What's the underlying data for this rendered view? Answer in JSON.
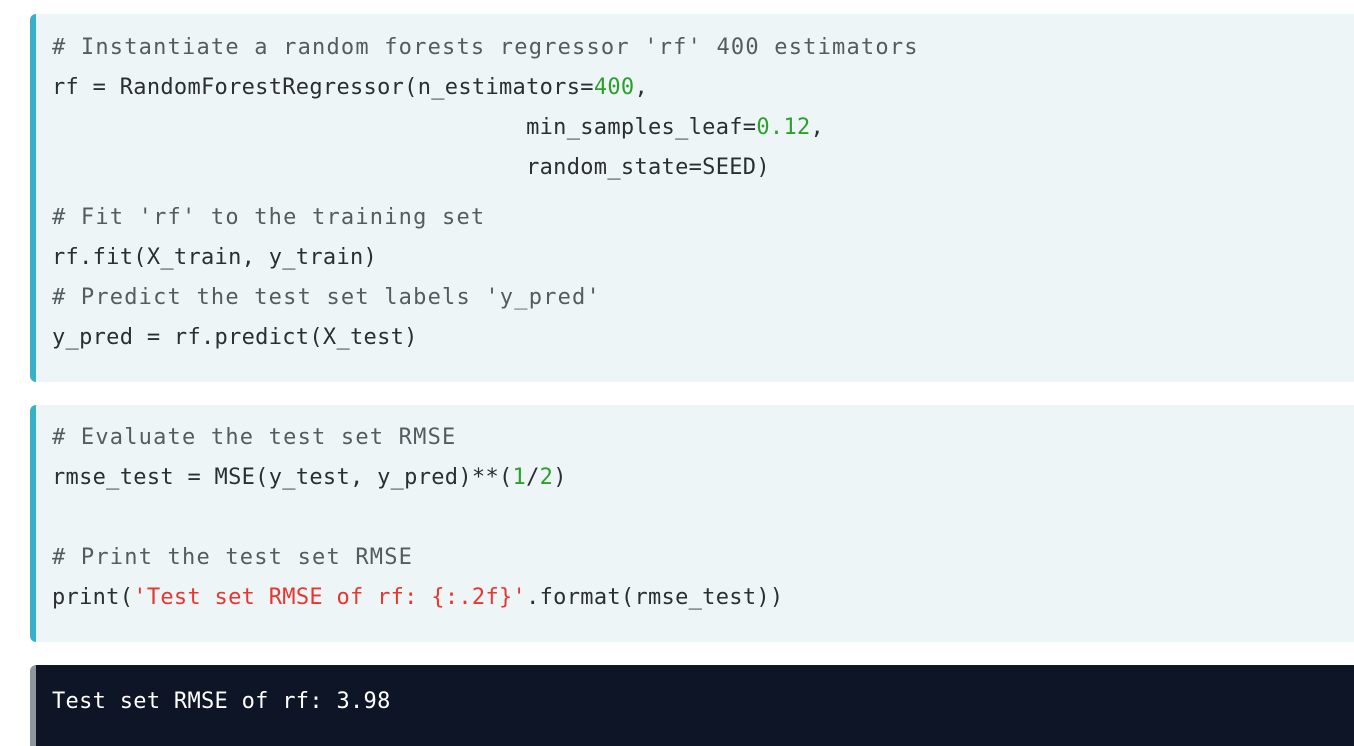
{
  "cell1": {
    "comment1": "# Instantiate a random forests regressor 'rf' 400 estimators",
    "line2_a": "rf = RandomForestRegressor(n_estimators=",
    "line2_num": "400",
    "line2_b": ",",
    "line3_a": "                                   min_samples_leaf=",
    "line3_num": "0.12",
    "line3_b": ",",
    "line4": "                                   random_state=SEED)",
    "comment2": "# Fit 'rf' to the training set",
    "line6": "rf.fit(X_train, y_train)",
    "comment3": "# Predict the test set labels 'y_pred'",
    "line8": "y_pred = rf.predict(X_test)"
  },
  "cell2": {
    "comment1": "# Evaluate the test set RMSE",
    "line2_a": "rmse_test = MSE(y_test, y_pred)**(",
    "line2_num1": "1",
    "line2_slash": "/",
    "line2_num2": "2",
    "line2_b": ")",
    "comment2": "# Print the test set RMSE",
    "line5_a": "print(",
    "line5_str": "'Test set RMSE of rf: {:.2f}'",
    "line5_b": ".format(rmse_test))"
  },
  "output": {
    "text": "Test set RMSE of rf: 3.98"
  }
}
